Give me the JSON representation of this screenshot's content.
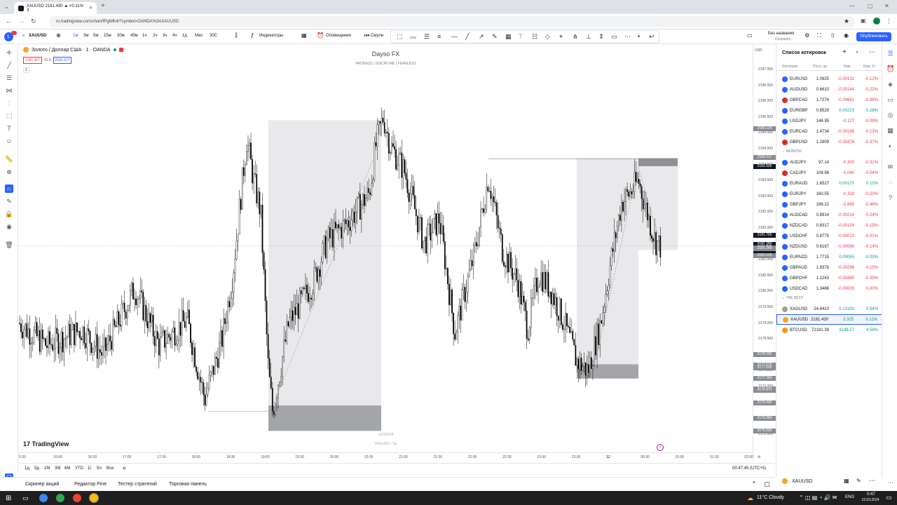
{
  "browser": {
    "tab_title": "XAUUSD 2181.430 ▲ +0.11% З",
    "url": "ru.tradingview.com/chart/fPgMlh4/?symbol=OANDA%3AXAUUSD"
  },
  "header": {
    "symbol": "XAUUSD",
    "intervals": [
      "1м",
      "3м",
      "5м",
      "15м",
      "30м",
      "45м",
      "1ч",
      "2ч",
      "3ч",
      "4ч",
      "1д",
      "Мес",
      "30С"
    ],
    "indicators": "Индикаторы",
    "alerts": "Оповещения",
    "replay": "Смулн",
    "layout_name": "Без названия",
    "layout_status": "Сохранён",
    "publish": "Опубликовать"
  },
  "legend": {
    "title": "Золото / Доллар США · 1 · OANDA",
    "bid": "2181.367",
    "spread": "31.0",
    "ask": "2181.677",
    "collapse": "1"
  },
  "watermark": {
    "title": "Dayso FX",
    "subtitle": "PATIENCE  |  DISCIPLINE  |  FEARLESS"
  },
  "chart_overlay": {
    "date": "11/3/2024",
    "symbol": "XAUUSD | 1м",
    "logo": "TradingView"
  },
  "price_ticks": [
    "2187.000",
    "2186.500",
    "2186.000",
    "2185.500",
    "2185.000",
    "2184.500",
    "2184.000",
    "2183.500",
    "2183.000",
    "2182.500",
    "2182.000",
    "2181.500",
    "2181.000",
    "2180.500",
    "2180.000",
    "2179.500",
    "2179.000",
    "2178.500",
    "2178.000",
    "2177.500",
    "2177.000",
    "2176.500",
    "2176.000",
    "2175.500"
  ],
  "price_labels": [
    "2185.125",
    "2184.224",
    "2184.217",
    "2183.935",
    "2181.765",
    "2181.483",
    "2181.430",
    "00:15",
    "2181.370",
    "2181.345",
    "2181.135",
    "2178.000",
    "2177.675",
    "2177.595",
    "2177.254",
    "2176.916",
    "2176.871",
    "2176.490",
    "2175.984",
    "2175.600"
  ],
  "price_scale": {
    "currency": "USD"
  },
  "time_ticks": [
    "5:30",
    "16:00",
    "16:30",
    "17:00",
    "17:30",
    "18:00",
    "18:30",
    "19:00",
    "19:30",
    "20:00",
    "20:30",
    "21:00",
    "21:30",
    "22:00",
    "22:30",
    "23:00",
    "23:30",
    "12",
    "00:30",
    "01:00",
    "01:30",
    "02:00"
  ],
  "bottom_bar": {
    "ranges": [
      "1д",
      "5д",
      "1М",
      "3М",
      "6М",
      "YTD",
      "1г",
      "5л",
      "Все"
    ],
    "clock": "00:47:45 (UTC+5)"
  },
  "footer": {
    "tabs": [
      "Скринер акций",
      "Редактор Pine",
      "Тестер стратегий",
      "Торговая панель"
    ]
  },
  "watchlist": {
    "title": "Список котировок",
    "columns": [
      "Инструме",
      "Посл. це",
      "Изм.",
      "Изм. %"
    ],
    "groups": [
      {
        "label": "",
        "rows": [
          {
            "sym": "EURUSD",
            "last": "1.0925",
            "chg": "-0.00132",
            "chp": "-0.12%",
            "dir": "neg",
            "color": "#2962ff"
          },
          {
            "sym": "AUDUSD",
            "last": "0.6610",
            "chg": "-0.00144",
            "chp": "-0.22%",
            "dir": "neg",
            "color": "#2962ff"
          },
          {
            "sym": "GBPCAD",
            "last": "1.7274",
            "chg": "-0.00661",
            "chp": "-0.38%",
            "dir": "neg",
            "color": "#d32f2f"
          },
          {
            "sym": "EURGBP",
            "last": "0.8529",
            "chg": "0.00223",
            "chp": "0.26%",
            "dir": "pos",
            "color": "#2962ff"
          },
          {
            "sym": "USDJPY",
            "last": "146.95",
            "chg": "-0.127",
            "chp": "-0.09%",
            "dir": "neg",
            "color": "#2962ff"
          },
          {
            "sym": "EURCAD",
            "last": "1.4734",
            "chg": "-0.00188",
            "chp": "-0.13%",
            "dir": "neg",
            "color": "#2962ff"
          },
          {
            "sym": "GBPUSD",
            "last": "1.2809",
            "chg": "-0.00478",
            "chp": "-0.37%",
            "dir": "neg",
            "color": "#d32f2f"
          }
        ]
      },
      {
        "label": "ВАЛЮТЫ",
        "rows": [
          {
            "sym": "AUDJPY",
            "last": "97.14",
            "chg": "-0.300",
            "chp": "-0.31%",
            "dir": "neg",
            "color": "#2962ff"
          },
          {
            "sym": "CADJPY",
            "last": "108.96",
            "chg": "-0.040",
            "chp": "-0.04%",
            "dir": "neg",
            "color": "#d32f2f"
          },
          {
            "sym": "EURAUD",
            "last": "1.6527",
            "chg": "0.00170",
            "chp": "0.10%",
            "dir": "pos",
            "color": "#2962ff"
          },
          {
            "sym": "EURJPY",
            "last": "160.55",
            "chg": "-0.318",
            "chp": "-0.20%",
            "dir": "neg",
            "color": "#2962ff"
          },
          {
            "sym": "GBPJPY",
            "last": "188.22",
            "chg": "-0.865",
            "chp": "-0.46%",
            "dir": "neg",
            "color": "#2962ff"
          },
          {
            "sym": "AUDCAD",
            "last": "0.8914",
            "chg": "-0.00214",
            "chp": "-0.24%",
            "dir": "neg",
            "color": "#2962ff"
          },
          {
            "sym": "NZDCAD",
            "last": "0.8317",
            "chg": "-0.00124",
            "chp": "-0.15%",
            "dir": "neg",
            "color": "#2962ff"
          },
          {
            "sym": "USDCHF",
            "last": "0.8775",
            "chg": "-0.00013",
            "chp": "-0.01%",
            "dir": "neg",
            "color": "#2962ff"
          },
          {
            "sym": "NZDUSD",
            "last": "0.6167",
            "chg": "-0.00086",
            "chp": "-0.14%",
            "dir": "neg",
            "color": "#2962ff"
          },
          {
            "sym": "EURNZD",
            "last": "1.7715",
            "chg": "0.00055",
            "chp": "0.03%",
            "dir": "pos",
            "color": "#2962ff"
          },
          {
            "sym": "GBPAUD",
            "last": "1.9376",
            "chg": "-0.00298",
            "chp": "-0.15%",
            "dir": "neg",
            "color": "#2962ff"
          },
          {
            "sym": "GBPCHF",
            "last": "1.1243",
            "chg": "-0.00445",
            "chp": "-0.39%",
            "dir": "neg",
            "color": "#2962ff"
          },
          {
            "sym": "USDCAD",
            "last": "1.3486",
            "chg": "-0.00005",
            "chp": "0.00%",
            "dir": "neg",
            "color": "#2962ff"
          }
        ]
      },
      {
        "label": "THE BEST",
        "rows": [
          {
            "sym": "XAGUSD",
            "last": "24.4410",
            "chg": "0.13100",
            "chp": "0.54%",
            "dir": "pos",
            "color": "#9e9e9e"
          },
          {
            "sym": "XAUUSD",
            "last": "2181.430",
            "chg": "2.325",
            "chp": "0.11%",
            "dir": "pos",
            "color": "#f5a623",
            "selected": true
          },
          {
            "sym": "BTCUSD",
            "last": "72181.39",
            "chg": "3149.27",
            "chp": "4.56%",
            "dir": "pos",
            "color": "#f7931a"
          }
        ]
      }
    ],
    "detail_symbol": "XAUUSD"
  },
  "taskbar": {
    "weather": "11°C  Cloudy",
    "lang": "ENG",
    "time": "0:47",
    "date": "12.03.2024"
  },
  "colors": {
    "accent": "#2962ff",
    "up": "#089981",
    "down": "#f23645",
    "candle": "#000000"
  }
}
